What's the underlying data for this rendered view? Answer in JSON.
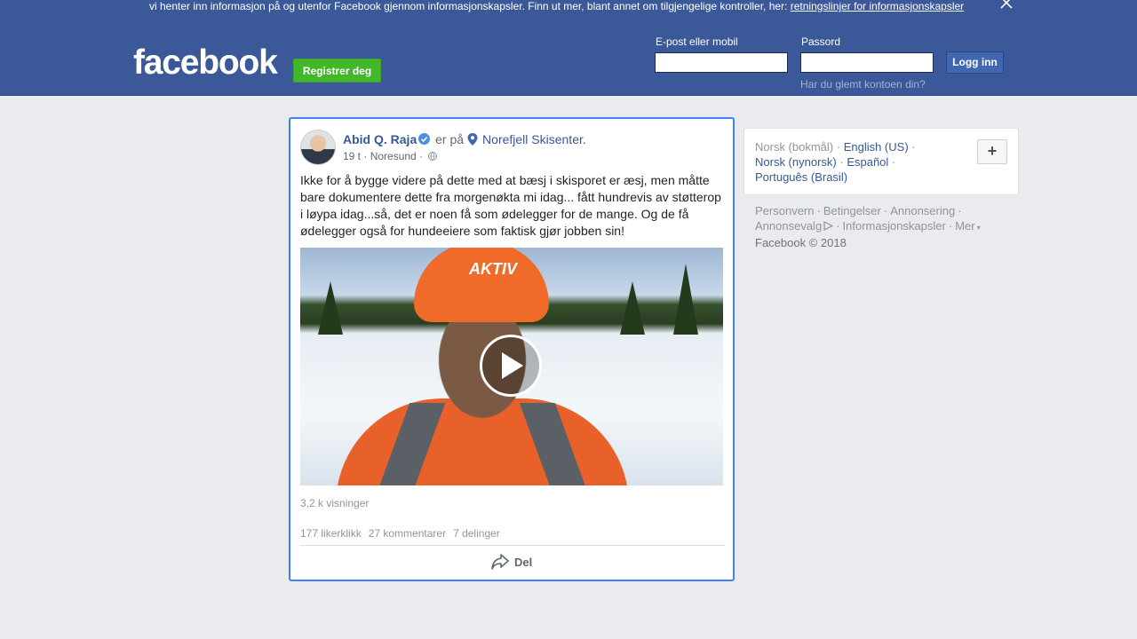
{
  "cookie_banner": {
    "text": "vi henter inn informasjon på og utenfor Facebook gjennom informasjonskapsler. Finn ut mer, blant annet om tilgjengelige kontroller, her: ",
    "link": "retningslinjer for informasjonskapsler"
  },
  "header": {
    "logo": "facebook",
    "register_label": "Registrer deg",
    "email_label": "E-post eller mobil",
    "email_value": "",
    "password_label": "Passord",
    "password_value": "",
    "login_label": "Logg inn",
    "forgot_label": "Har du glemt kontoen din?"
  },
  "post": {
    "author": "Abid Q. Raja",
    "action": "er på",
    "place": "Norefjell Skisenter.",
    "time": "19 t",
    "location": "Noresund",
    "text": "Ikke for å bygge videre på dette med at bæsj i skisporet er æsj, men måtte bare dokumentere dette fra morgenøkta mi idag... fått hundrevis av støtterop i løypa idag...så, det er noen få som ødelegger for de mange. Og de få ødelegger også for hundeeiere som faktisk gjør jobben sin!",
    "video_caption": "AKTIV",
    "views": "3,2 k visninger",
    "likes": "177 likerklikk",
    "comments": "27 kommentarer",
    "shares": "7 delinger",
    "share_label": "Del"
  },
  "languages": {
    "current": "Norsk (bokmål)",
    "items": [
      "English (US)",
      "Norsk (nynorsk)",
      "Español",
      "Português (Brasil)"
    ],
    "add_label": "+"
  },
  "footer": {
    "links": [
      "Personvern",
      "Betingelser",
      "Annonsering",
      "Annonsevalg",
      "Informasjonskapsler",
      "Mer"
    ],
    "copyright": "Facebook © 2018"
  },
  "colors": {
    "brand_blue": "#3b5998",
    "register_green": "#42b72a",
    "link_blue": "#365899",
    "focus_border": "#4080ff"
  }
}
